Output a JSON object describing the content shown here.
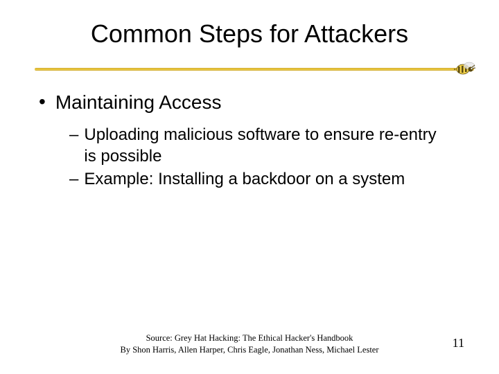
{
  "title": "Common Steps for Attackers",
  "bullets": {
    "level1": "Maintaining Access",
    "level2": [
      "Uploading malicious software to ensure re-entry is possible",
      "Example: Installing a backdoor on a system"
    ]
  },
  "source": {
    "line1": "Source: Grey Hat Hacking: The Ethical Hacker's Handbook",
    "line2": "By Shon Harris, Allen Harper, Chris Eagle, Jonathan Ness, Michael Lester"
  },
  "page_number": "11",
  "accent_color": "#d4af37"
}
